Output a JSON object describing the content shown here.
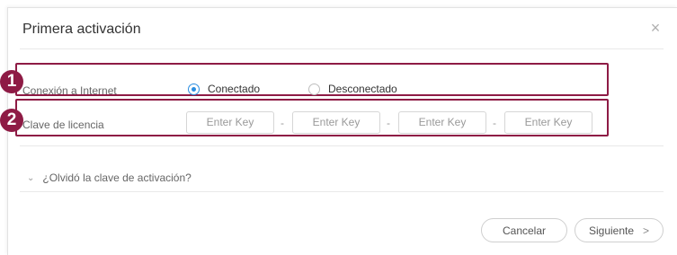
{
  "dialog": {
    "title": "Primera activación",
    "close_glyph": "×"
  },
  "markers": [
    "1",
    "2"
  ],
  "internet": {
    "label": "Conexión a Internet",
    "options": [
      {
        "label": "Conectado",
        "selected": true
      },
      {
        "label": "Desconectado",
        "selected": false
      }
    ]
  },
  "license": {
    "label": "Clave de licencia",
    "placeholders": [
      "Enter Key",
      "Enter Key",
      "Enter Key",
      "Enter Key"
    ],
    "separator": "-"
  },
  "forgot": {
    "label": "¿Olvidó la clave de activación?"
  },
  "footer": {
    "cancel_label": "Cancelar",
    "next_label": "Siguiente",
    "next_arrow": ">"
  },
  "colors": {
    "accent_marker": "#8e1b45",
    "radio_selected": "#2a8de0"
  }
}
